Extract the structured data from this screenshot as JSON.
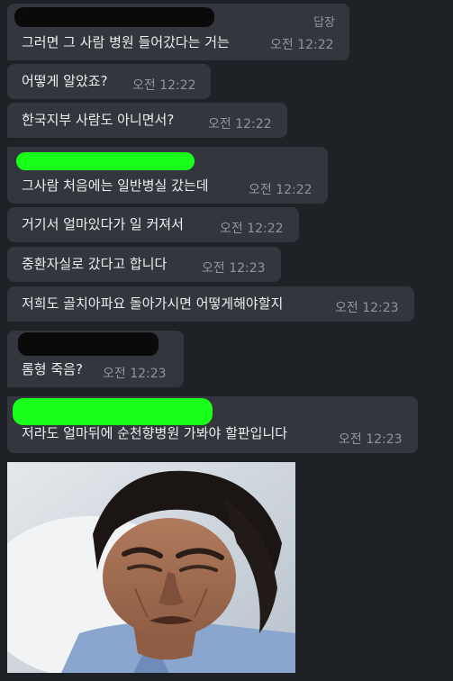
{
  "chat": {
    "messages": [
      {
        "text": "그러면 그 사람 병원 들어갔다는 거는",
        "time": "오전 12:22",
        "reply_label": "답장"
      },
      {
        "text": "어떻게 알았죠?",
        "time": "오전 12:22"
      },
      {
        "text": "한국지부 사람도 아니면서?",
        "time": "오전 12:22"
      },
      {
        "text": "그사람 처음에는 일반병실 갔는데",
        "time": "오전 12:22"
      },
      {
        "text": "거기서 얼마있다가 일 커져서",
        "time": "오전 12:22"
      },
      {
        "text": "중환자실로 갔다고 합니다",
        "time": "오전 12:23"
      },
      {
        "text": "저희도 골치아파요 돌아가시면 어떻게해야할지",
        "time": "오전 12:23"
      },
      {
        "text": "롬형 죽음?",
        "time": "오전 12:23"
      },
      {
        "text": "저라도 얼마뒤에 순천향병원 가봐야 할판입니다",
        "time": "오전 12:23"
      }
    ]
  },
  "colors": {
    "background": "#1e2126",
    "bubble": "#33373d",
    "redaction_black": "#0a0a0a",
    "redaction_green": "#19ff19"
  }
}
